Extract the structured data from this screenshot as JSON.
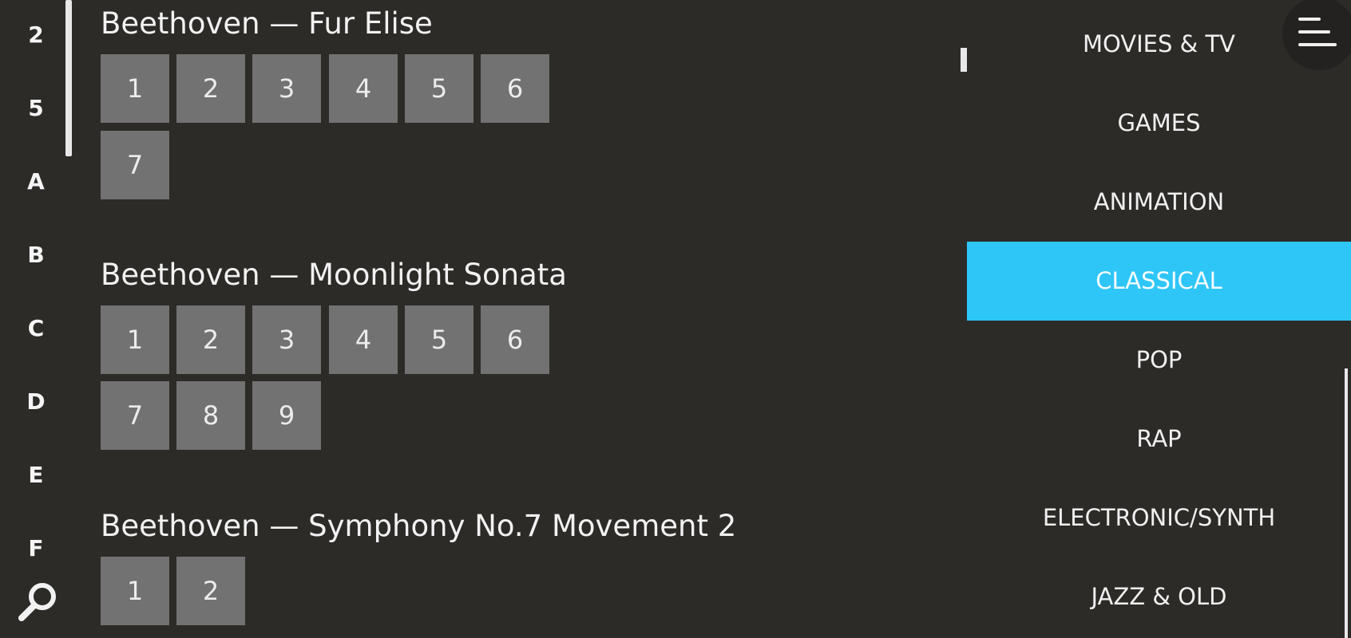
{
  "index": {
    "items": [
      "2",
      "5",
      "A",
      "B",
      "C",
      "D",
      "E",
      "F"
    ]
  },
  "icons": {
    "search": "search-icon",
    "menu": "hamburger-menu-icon"
  },
  "songs": [
    {
      "title": "Beethoven — Fur Elise",
      "parts": [
        "1",
        "2",
        "3",
        "4",
        "5",
        "6",
        "7"
      ]
    },
    {
      "title": "Beethoven — Moonlight Sonata",
      "parts": [
        "1",
        "2",
        "3",
        "4",
        "5",
        "6",
        "7",
        "8",
        "9"
      ]
    },
    {
      "title": "Beethoven — Symphony No.7 Movement 2",
      "parts": [
        "1",
        "2"
      ]
    }
  ],
  "categories": {
    "items": [
      "MOVIES & TV",
      "GAMES",
      "ANIMATION",
      "CLASSICAL",
      "POP",
      "RAP",
      "ELECTRONIC/SYNTH",
      "JAZZ & OLD"
    ],
    "selected": "CLASSICAL"
  },
  "colors": {
    "background": "#2c2b28",
    "part_button": "#727272",
    "active_category": "#2ec6f7",
    "text": "#f2f2f2"
  }
}
